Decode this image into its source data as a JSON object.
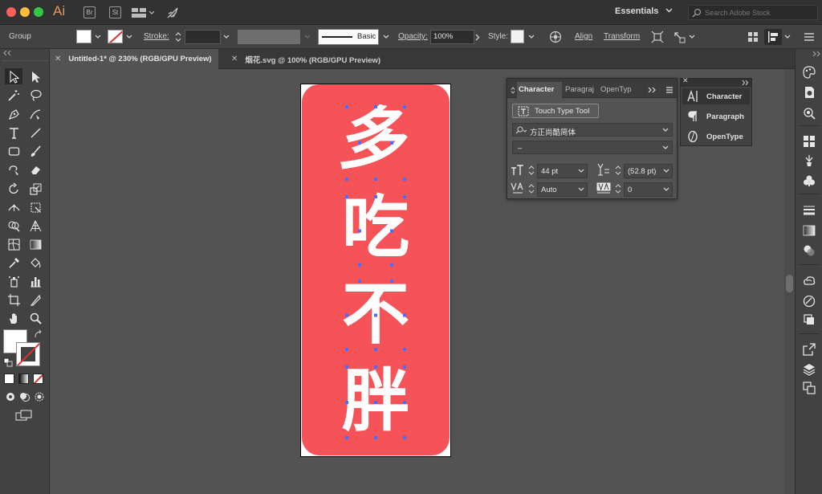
{
  "app": {
    "logo": "Ai",
    "bridge": "Br",
    "stock": "St"
  },
  "workspace": {
    "label": "Essentials"
  },
  "search": {
    "placeholder": "Search Adobe Stock"
  },
  "control": {
    "selection_label": "Group",
    "stroke_label": "Stroke:",
    "brush_label": "Basic",
    "opacity_label": "Opacity:",
    "opacity_value": "100%",
    "style_label": "Style:",
    "align_label": "Align",
    "transform_label": "Transform"
  },
  "tabs": [
    {
      "label": "Untitled-1* @ 230% (RGB/GPU Preview)",
      "active": true
    },
    {
      "label": "烟花.svg @ 100% (RGB/GPU Preview)",
      "active": false
    }
  ],
  "artwork": {
    "background_color": "#f65358",
    "glyphs": [
      "多",
      "吃",
      "不",
      "胖"
    ]
  },
  "character_panel": {
    "tabs": [
      "Character",
      "Paragraj",
      "OpenTyp"
    ],
    "touch_type_label": "Touch Type Tool",
    "font_family": "方正尚酷简体",
    "font_style": "–",
    "font_size": "44 pt",
    "leading": "(52.8 pt)",
    "kerning": "Auto",
    "tracking": "0"
  },
  "dock": {
    "items": [
      "Character",
      "Paragraph",
      "OpenType"
    ]
  },
  "colors": {
    "accent_selection": "#4a6cff",
    "ui_dark": "#323232",
    "canvas": "#535353"
  }
}
